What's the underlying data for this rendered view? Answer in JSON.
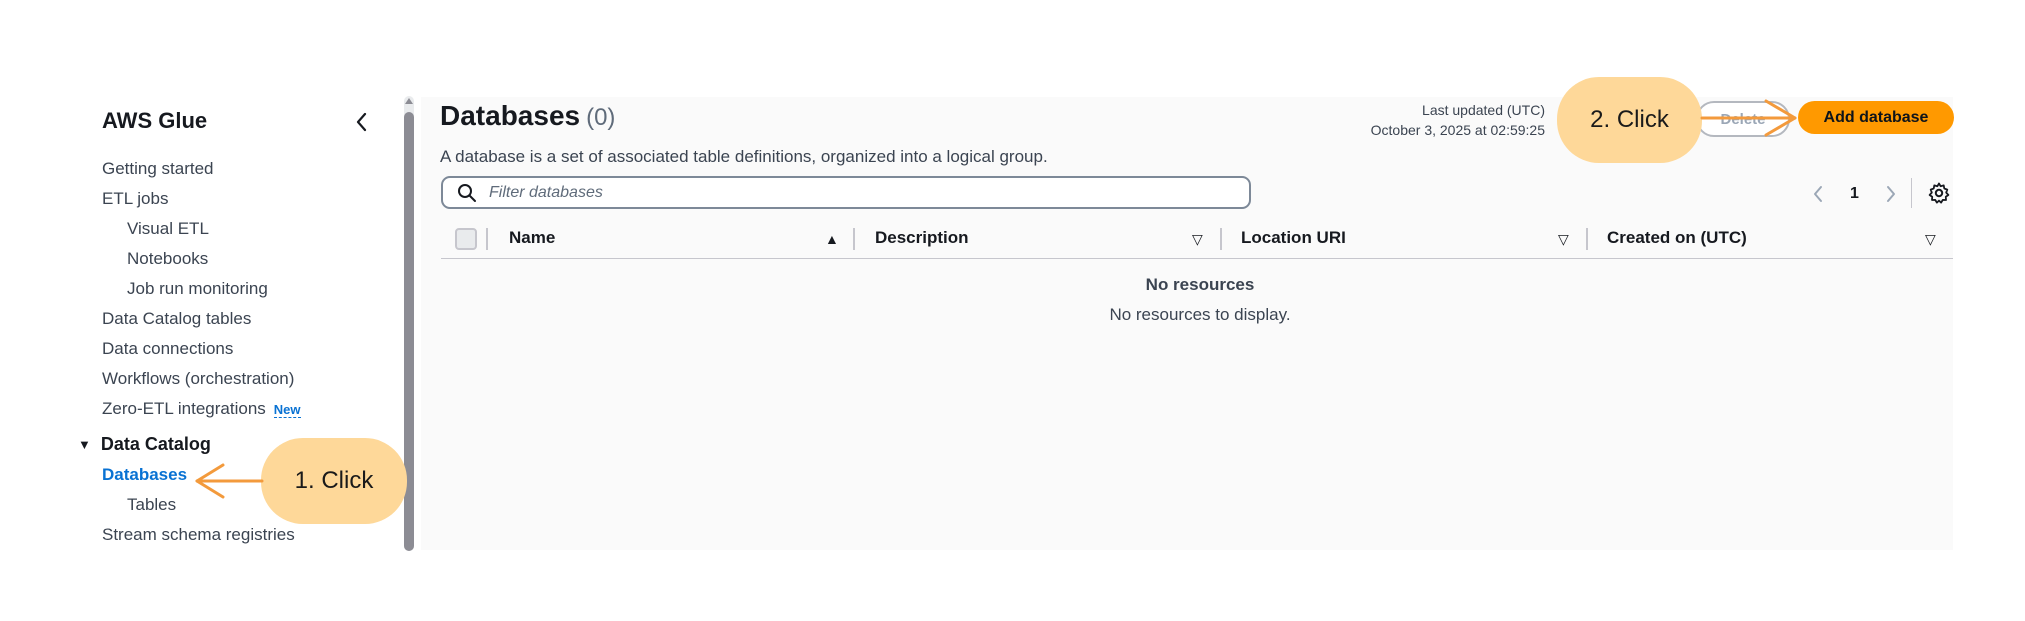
{
  "sidebar": {
    "title": "AWS Glue",
    "collapse_icon": "chevron-left-icon",
    "items": [
      {
        "label": "Getting started"
      },
      {
        "label": "ETL jobs"
      },
      {
        "label": "Visual ETL"
      },
      {
        "label": "Notebooks"
      },
      {
        "label": "Job run monitoring"
      },
      {
        "label": "Data Catalog tables"
      },
      {
        "label": "Data connections"
      },
      {
        "label": "Workflows (orchestration)"
      },
      {
        "label": "Zero-ETL integrations",
        "badge": "New"
      }
    ],
    "section": {
      "label": "Data Catalog",
      "items": [
        {
          "label": "Databases",
          "active": true
        },
        {
          "label": "Tables"
        }
      ]
    },
    "after_section": [
      {
        "label": "Stream schema registries"
      }
    ]
  },
  "main": {
    "title": "Databases",
    "count": "(0)",
    "description": "A database is a set of associated table definitions, organized into a logical group.",
    "last_updated_label": "Last updated (UTC)",
    "last_updated_value": "October 3, 2025 at 02:59:25",
    "delete_label": "Delete",
    "add_label": "Add database",
    "filter_placeholder": "Filter databases",
    "page_number": "1",
    "columns": [
      "Name",
      "Description",
      "Location URI",
      "Created on (UTC)"
    ],
    "empty_title": "No resources",
    "empty_text": "No resources to display."
  },
  "annotations": {
    "step1": "1. Click",
    "step2": "2. Click"
  },
  "colors": {
    "accent_orange": "#ff9900",
    "link_blue": "#0972d3",
    "bubble": "#fed899",
    "arrow": "#f39a3c"
  }
}
